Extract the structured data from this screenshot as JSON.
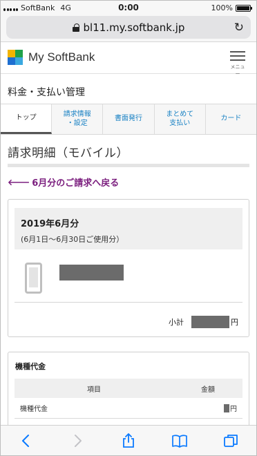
{
  "status_bar": {
    "carrier": "SoftBank",
    "network": "4G",
    "time": "0:00",
    "battery": "100%"
  },
  "browser": {
    "url": "bl11.my.softbank.jp"
  },
  "site": {
    "logo_text": "My SoftBank",
    "menu_label": "メニュー"
  },
  "section": {
    "title": "料金・支払い管理"
  },
  "tabs": [
    {
      "label": "トップ",
      "active": true
    },
    {
      "label": "請求情報\n・設定",
      "active": false
    },
    {
      "label": "書面発行",
      "active": false
    },
    {
      "label": "まとめて\n支払い",
      "active": false
    },
    {
      "label": "カード",
      "active": false
    }
  ],
  "page": {
    "heading": "請求明細（モバイル）",
    "back_link": "6月分のご請求へ戻る"
  },
  "summary": {
    "period_title": "2019年6月分",
    "period_range": "(6月1日〜6月30日ご使用分）",
    "subtotal_label": "小計",
    "yen": "円"
  },
  "detail": {
    "title": "機種代金",
    "columns": [
      "項目",
      "金額"
    ],
    "rows": [
      {
        "item": "機種代金",
        "yen": "円"
      }
    ]
  },
  "toolbar": {
    "icons": [
      "back-icon",
      "forward-icon",
      "share-icon",
      "bookmarks-icon",
      "tabs-icon"
    ]
  },
  "colors": {
    "link_blue": "#1a82c4",
    "back_link_purple": "#7b1e7e",
    "ios_blue": "#0a7aff"
  }
}
